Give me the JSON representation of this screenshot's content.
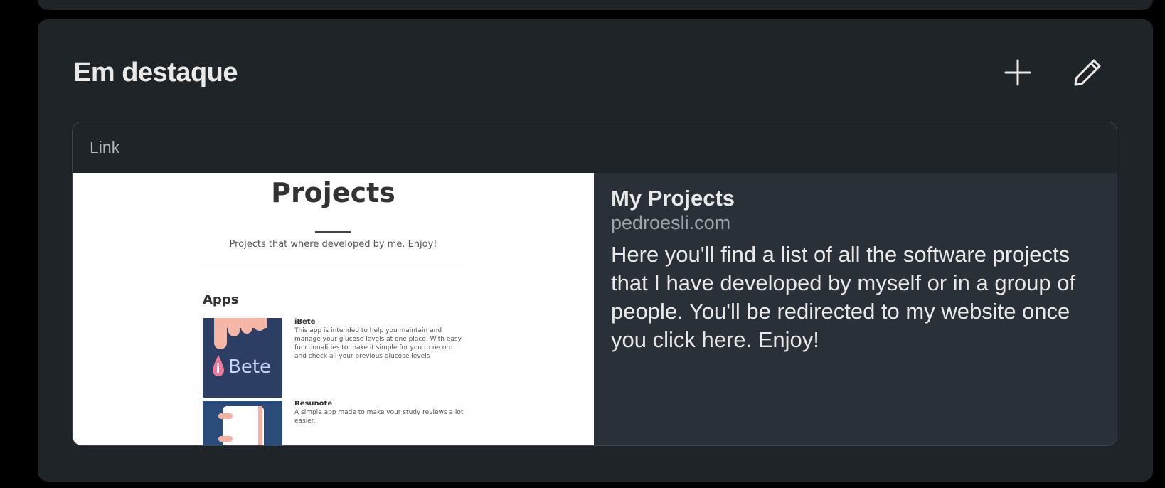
{
  "section": {
    "title": "Em destaque",
    "add_icon": "plus-icon",
    "edit_icon": "pencil-icon"
  },
  "featured_item": {
    "type_label": "Link",
    "title": "My Projects",
    "domain": "pedroesli.com",
    "description": "Here you'll find a list of all the software projects that I have developed by myself or in a group of people. You'll be redirected to my website once you click here. Enjoy!",
    "thumbnail": {
      "title": "Projects",
      "subtitle": "Projects that where developed by me. Enjoy!",
      "section_label": "Apps",
      "apps": [
        {
          "name": "iBete",
          "logo_text": "Bete",
          "description": "This app is intended to help you maintain and manage your glucose levels at one place. With easy functionalities to make it simple for you to record and check all your previous glucose levels"
        },
        {
          "name": "Resunote",
          "description": "A simple app made to make your study reviews a lot easier."
        }
      ]
    }
  },
  "colors": {
    "background": "#000000",
    "card": "#1f2428",
    "info_panel": "#293038",
    "text_primary": "#e9e9e9",
    "text_secondary": "#9ea3a8"
  }
}
